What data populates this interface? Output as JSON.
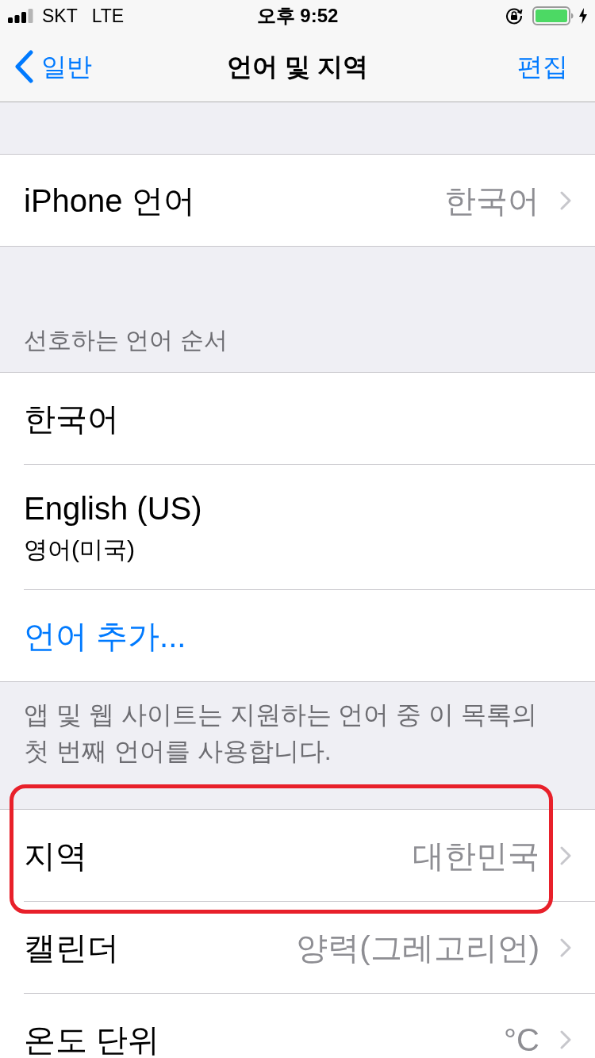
{
  "status_bar": {
    "carrier": "SKT",
    "network": "LTE",
    "time": "오후 9:52"
  },
  "nav_bar": {
    "back": "일반",
    "title": "언어 및 지역",
    "action": "편집"
  },
  "sections": [
    {
      "rows": [
        {
          "kind": "value",
          "label": "iPhone 언어",
          "value": "한국어",
          "highlighted": false
        }
      ]
    },
    {
      "header": "선호하는 언어 순서",
      "rows": [
        {
          "kind": "plain",
          "label": "한국어",
          "highlighted": false
        },
        {
          "kind": "subtitle",
          "label": "English (US)",
          "subtitle": "영어(미국)",
          "highlighted": false
        },
        {
          "kind": "link",
          "label": "언어 추가...",
          "highlighted": false
        }
      ],
      "footer": "앱 및 웹 사이트는 지원하는 언어 중 이 목록의 첫 번째 언어를 사용합니다."
    },
    {
      "rows": [
        {
          "kind": "value",
          "label": "지역",
          "value": "대한민국",
          "highlighted": true
        },
        {
          "kind": "value",
          "label": "캘린더",
          "value": "양력(그레고리언)",
          "highlighted": false
        },
        {
          "kind": "value",
          "label": "온도 단위",
          "value": "°C",
          "highlighted": false
        }
      ]
    }
  ]
}
